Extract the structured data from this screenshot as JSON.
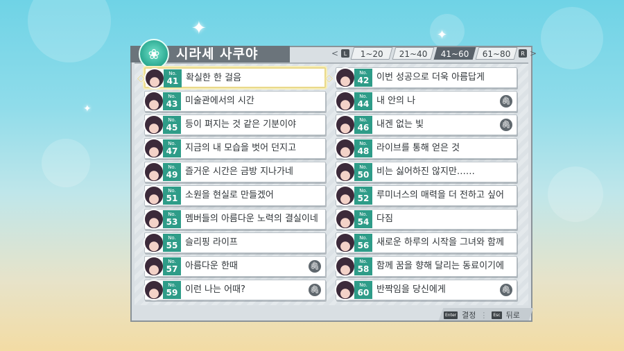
{
  "character_name": "시라세 사쿠야",
  "tabs": [
    {
      "label": "1~20",
      "active": false
    },
    {
      "label": "21~40",
      "active": false
    },
    {
      "label": "41~60",
      "active": true
    },
    {
      "label": "61~80",
      "active": false
    }
  ],
  "tab_keys": {
    "left": "L",
    "right": "R"
  },
  "number_prefix": "No.",
  "episodes": [
    {
      "no": "41",
      "title": "확실한 한 걸음",
      "clip": false,
      "selected": true
    },
    {
      "no": "42",
      "title": "이번 성공으로 더욱 아름답게",
      "clip": false
    },
    {
      "no": "43",
      "title": "미술관에서의 시간",
      "clip": false
    },
    {
      "no": "44",
      "title": "내 안의 나",
      "clip": true
    },
    {
      "no": "45",
      "title": "등이 펴지는 것 같은 기분이야",
      "clip": false
    },
    {
      "no": "46",
      "title": "내겐 없는 빛",
      "clip": true
    },
    {
      "no": "47",
      "title": "지금의 내 모습을 벗어 던지고",
      "clip": false
    },
    {
      "no": "48",
      "title": "라이브를 통해 얻은 것",
      "clip": false
    },
    {
      "no": "49",
      "title": "즐거운 시간은 금방 지나가네",
      "clip": false
    },
    {
      "no": "50",
      "title": "비는 싫어하진 않지만……",
      "clip": false
    },
    {
      "no": "51",
      "title": "소원을 현실로 만들겠어",
      "clip": false
    },
    {
      "no": "52",
      "title": "루미너스의 매력을 더 전하고 싶어",
      "clip": false
    },
    {
      "no": "53",
      "title": "멤버들의 아름다운 노력의 결실이네",
      "clip": false
    },
    {
      "no": "54",
      "title": "다짐",
      "clip": false
    },
    {
      "no": "55",
      "title": "슬리핑 라이프",
      "clip": false
    },
    {
      "no": "56",
      "title": "새로운 하루의 시작을 그녀와 함께",
      "clip": false
    },
    {
      "no": "57",
      "title": "아름다운 한때",
      "clip": true
    },
    {
      "no": "58",
      "title": "함께 꿈을 향해 달리는 동료이기에",
      "clip": false
    },
    {
      "no": "59",
      "title": "이런 나는 어때?",
      "clip": true
    },
    {
      "no": "60",
      "title": "반짝임을 당신에게",
      "clip": true
    }
  ],
  "footer": {
    "confirm_key": "Enter",
    "confirm_label": "결정",
    "back_key": "Esc",
    "back_label": "뒤로"
  },
  "colors": {
    "badge": "#2e9c88",
    "active_tab": "#59626a",
    "selection": "#e9d98a"
  }
}
